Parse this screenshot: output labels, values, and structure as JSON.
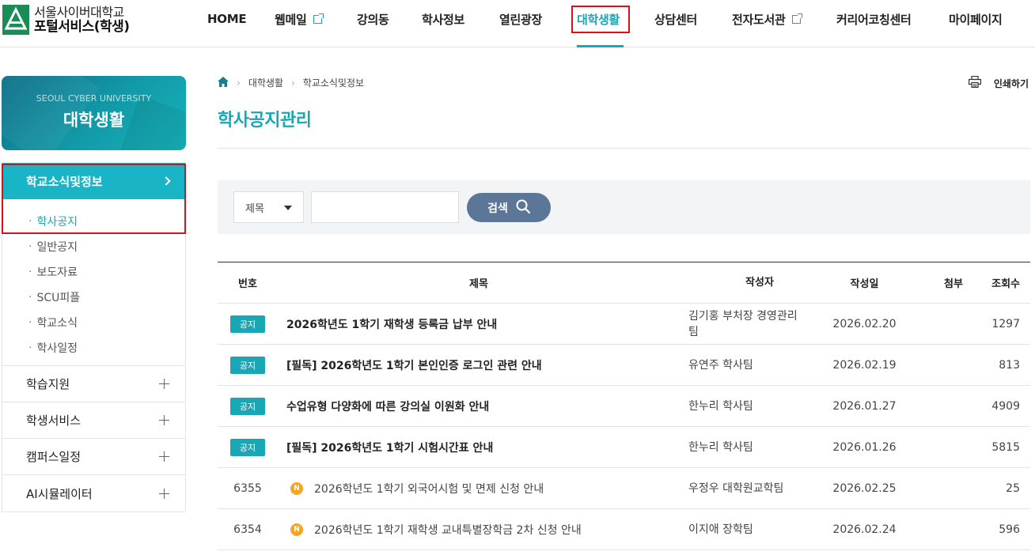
{
  "header": {
    "logo_line1": "서울사이버대학교",
    "logo_line2": "포털서비스(학생)",
    "nav": [
      {
        "label": "HOME"
      },
      {
        "label": "웹메일"
      },
      {
        "label": "강의동"
      },
      {
        "label": "학사정보"
      },
      {
        "label": "열린광장"
      },
      {
        "label": "대학생활"
      },
      {
        "label": "상담센터"
      },
      {
        "label": "전자도서관"
      },
      {
        "label": "커리어코칭센터"
      },
      {
        "label": "마이페이지"
      }
    ]
  },
  "sidebar": {
    "banner_univ": "SEOUL CYBER UNIVERSITY",
    "banner_title": "대학생활",
    "active_menu": "학교소식및정보",
    "sub_items": [
      {
        "label": "학사공지"
      },
      {
        "label": "일반공지"
      },
      {
        "label": "보도자료"
      },
      {
        "label": "SCU피플"
      },
      {
        "label": "학교소식"
      },
      {
        "label": "학사일정"
      }
    ],
    "other_menus": [
      {
        "label": "학습지원"
      },
      {
        "label": "학생서비스"
      },
      {
        "label": "캠퍼스일정"
      },
      {
        "label": "AI시뮬레이터"
      }
    ]
  },
  "breadcrumb": {
    "items": [
      "대학생활",
      "학교소식및정보"
    ]
  },
  "print_label": "인쇄하기",
  "page_title": "학사공지관리",
  "search": {
    "select_value": "제목",
    "input_value": "",
    "button_label": "검색"
  },
  "table": {
    "headers": {
      "no": "번호",
      "title": "제목",
      "author": "작성자",
      "date": "작성일",
      "attach": "첨부",
      "views": "조회수"
    },
    "notice_badge": "공지",
    "new_badge": "N",
    "rows": [
      {
        "no": "",
        "notice": true,
        "new": false,
        "title": "2026학년도 1학기 재학생 등록금 납부 안내",
        "author": "김기홍 부처장 경영관리팀",
        "date": "2026.02.20",
        "views": "1297"
      },
      {
        "no": "",
        "notice": true,
        "new": false,
        "title": "[필독] 2026학년도 1학기 본인인증 로그인 관련 안내",
        "author": "유연주 학사팀",
        "date": "2026.02.19",
        "views": "813"
      },
      {
        "no": "",
        "notice": true,
        "new": false,
        "title": "수업유형 다양화에 따른 강의실 이원화 안내",
        "author": "한누리 학사팀",
        "date": "2026.01.27",
        "views": "4909"
      },
      {
        "no": "",
        "notice": true,
        "new": false,
        "title": "[필독] 2026학년도 1학기 시험시간표 안내",
        "author": "한누리 학사팀",
        "date": "2026.01.26",
        "views": "5815"
      },
      {
        "no": "6355",
        "notice": false,
        "new": true,
        "title": "2026학년도 1학기 외국어시험 및 면제 신청 안내",
        "author": "우정우 대학원교학팀",
        "date": "2026.02.25",
        "views": "25"
      },
      {
        "no": "6354",
        "notice": false,
        "new": true,
        "title": "2026학년도 1학기 재학생 교내특별장학금 2차 신청 안내",
        "author": "이지애 장학팀",
        "date": "2026.02.24",
        "views": "596"
      }
    ]
  },
  "colors": {
    "accent": "#19a6b5",
    "highlight_box": "#d9121a",
    "search_button": "#5c7697",
    "new_badge": "#f5a623"
  }
}
